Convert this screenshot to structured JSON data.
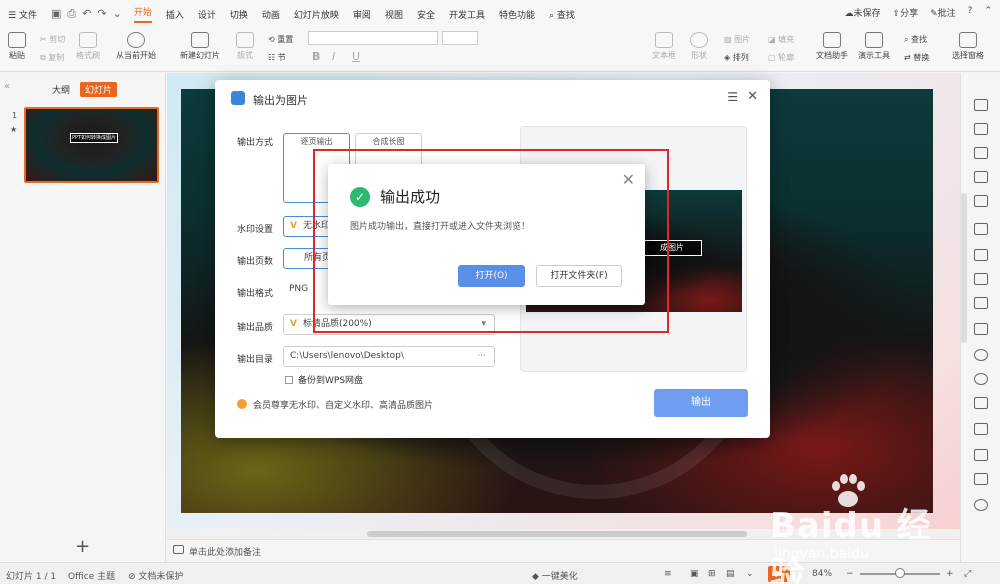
{
  "menubar": {
    "file": "文件",
    "tabs": [
      "开始",
      "插入",
      "设计",
      "切换",
      "动画",
      "幻灯片放映",
      "审阅",
      "视图",
      "安全",
      "开发工具",
      "特色功能"
    ],
    "active_tab": "开始",
    "search": "查找",
    "unsaved": "未保存",
    "share": "分享",
    "comment": "批注"
  },
  "ribbon": {
    "paste": "粘贴",
    "cut": "剪切",
    "copy": "复制",
    "format_painter": "格式刷",
    "from_current": "从当前开始",
    "new_slide": "新建幻灯片",
    "layout": "版式",
    "reset": "重置",
    "section": "节",
    "textbox": "文本框",
    "shape": "形状",
    "picture": "图片",
    "fill": "填充",
    "arrange": "排列",
    "outline": "轮廓",
    "doc_assistant": "文档助手",
    "present_tools": "演示工具",
    "find": "查找",
    "replace": "替换",
    "select_pane": "选择窗格"
  },
  "leftpanel": {
    "tab_outline": "大纲",
    "tab_slides": "幻灯片",
    "slide_number": "1",
    "thumb_title": "PPT如何转换成图片"
  },
  "notes": {
    "placeholder": "单击此处添加备注"
  },
  "statusbar": {
    "slide_info": "幻灯片 1 / 1",
    "theme": "Office 主题",
    "protection": "文档未保护",
    "beautify": "一键美化",
    "zoom": "84%"
  },
  "dialog": {
    "title": "输出为图片",
    "output_mode_label": "输出方式",
    "mode_per_page": "逐页输出",
    "mode_long": "合成长图",
    "watermark_label": "水印设置",
    "watermark_value": "无水印",
    "pages_label": "输出页数",
    "pages_value": "所有页",
    "format_label": "输出格式",
    "format_value": "PNG",
    "quality_label": "输出品质",
    "quality_value": "标清品质(200%)",
    "dir_label": "输出目录",
    "dir_value": "C:\\Users\\lenovo\\Desktop\\",
    "backup": "备份到WPS网盘",
    "vip": "会员尊享无水印、自定义水印、高清品质图片",
    "output_button": "输出",
    "preview_title": "成图片"
  },
  "popup": {
    "title": "输出成功",
    "message": "图片成功输出，直接打开或进入文件夹浏览！",
    "open_button": "打开(O)",
    "folder_button": "打开文件夹(F)"
  },
  "watermark": {
    "brand": "Baidu 经验",
    "url": "jingyan.baidu"
  }
}
